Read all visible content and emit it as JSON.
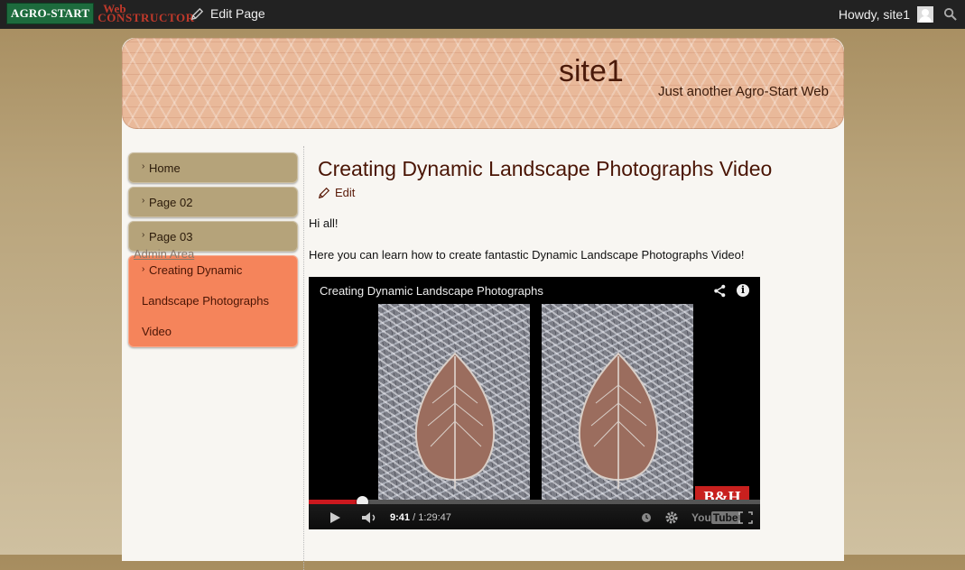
{
  "adminbar": {
    "logo_primary": "AGRO-START",
    "logo_secondary_line1": "Web",
    "logo_secondary_line2": "CONSTRUCTOR",
    "edit_page_label": "Edit Page",
    "howdy_label": "Howdy, site1",
    "icons": [
      "pencil-icon",
      "avatar",
      "search-icon"
    ]
  },
  "header": {
    "site_title": "site1",
    "site_description": "Just another Agro-Start Web"
  },
  "sidebar": {
    "items": [
      {
        "label": "Home",
        "active": false
      },
      {
        "label": "Page 02",
        "active": false
      },
      {
        "label": "Page 03",
        "active": false
      },
      {
        "label": "Creating Dynamic Landscape Photographs Video",
        "active": true
      }
    ],
    "admin_link": "Admin Area"
  },
  "content": {
    "title": "Creating Dynamic Landscape Photographs Video",
    "edit_label": "Edit",
    "paragraph1": "Hi all!",
    "paragraph2": "Here you can learn how to create fantastic Dynamic Landscape Photographs Video!"
  },
  "video": {
    "title": "Creating Dynamic Landscape Photographs",
    "current_time": "9:41",
    "total_time": "/ 1:29:47",
    "progress_fraction": 0.118,
    "channel_badge": "B&H",
    "yt_logo_text": "You",
    "yt_logo_box": "Tube"
  },
  "colors": {
    "accent_active": "#f5845b",
    "nav_bg": "#b5a37a",
    "title_color": "#4a1505",
    "progress": "#cc181e"
  }
}
